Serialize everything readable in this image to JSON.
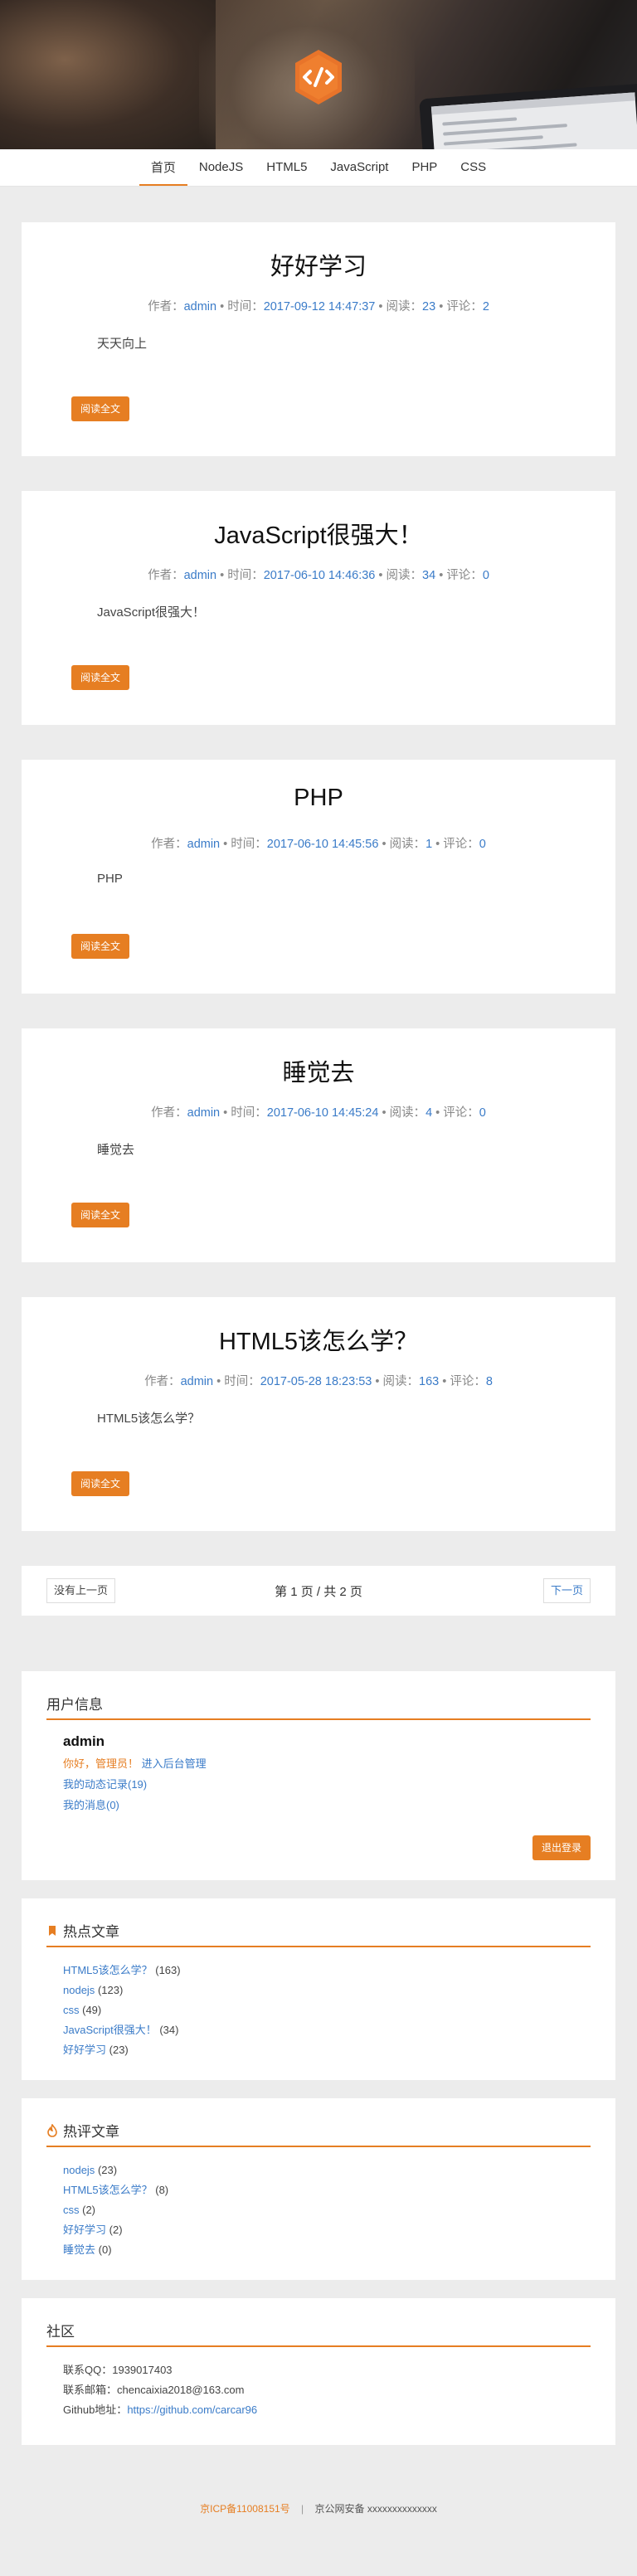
{
  "nav": {
    "items": [
      "首页",
      "NodeJS",
      "HTML5",
      "JavaScript",
      "PHP",
      "CSS"
    ]
  },
  "labels": {
    "author": "作者：",
    "time": "时间：",
    "reads": "阅读：",
    "comments": "评论：",
    "dot": " • ",
    "read_more": "阅读全文"
  },
  "posts": [
    {
      "title": "好好学习",
      "author": "admin",
      "time": "2017-09-12 14:47:37",
      "reads": "23",
      "comments": "2",
      "summary": "天天向上"
    },
    {
      "title": "JavaScript很强大！",
      "author": "admin",
      "time": "2017-06-10 14:46:36",
      "reads": "34",
      "comments": "0",
      "summary": "JavaScript很强大！"
    },
    {
      "title": "PHP",
      "author": "admin",
      "time": "2017-06-10 14:45:56",
      "reads": "1",
      "comments": "0",
      "summary": "PHP"
    },
    {
      "title": "睡觉去",
      "author": "admin",
      "time": "2017-06-10 14:45:24",
      "reads": "4",
      "comments": "0",
      "summary": "睡觉去"
    },
    {
      "title": "HTML5该怎么学？",
      "author": "admin",
      "time": "2017-05-28 18:23:53",
      "reads": "163",
      "comments": "8",
      "summary": "HTML5该怎么学？"
    }
  ],
  "pager": {
    "prev": "没有上一页",
    "info": "第 1 页 / 共 2 页",
    "next": "下一页"
  },
  "user_info": {
    "title": "用户信息",
    "name": "admin",
    "greeting": "你好，管理员！",
    "admin_link": "进入后台管理",
    "activity": "我的动态记录(19)",
    "messages": "我的消息(0)",
    "logout": "退出登录"
  },
  "hot_articles": {
    "title": "热点文章",
    "items": [
      {
        "label": "HTML5该怎么学？",
        "count": "(163)"
      },
      {
        "label": "nodejs",
        "count": "(123)"
      },
      {
        "label": "css",
        "count": "(49)"
      },
      {
        "label": "JavaScript很强大！",
        "count": "(34)"
      },
      {
        "label": "好好学习",
        "count": "(23)"
      }
    ]
  },
  "hot_comments": {
    "title": "热评文章",
    "items": [
      {
        "label": "nodejs",
        "count": "(23)"
      },
      {
        "label": "HTML5该怎么学？",
        "count": "(8)"
      },
      {
        "label": "css",
        "count": "(2)"
      },
      {
        "label": "好好学习",
        "count": "(2)"
      },
      {
        "label": "睡觉去",
        "count": "(0)"
      }
    ]
  },
  "community": {
    "title": "社区",
    "qq_label": "联系QQ：",
    "qq": "1939017403",
    "email_label": "联系邮箱：",
    "email": "chencaixia2018@163.com",
    "github_label": "Github地址：",
    "github": "https://github.com/carcar96"
  },
  "footer": {
    "icp": "京ICP备11008151号",
    "sep": "|",
    "police": "京公网安备 xxxxxxxxxxxxxx"
  },
  "colors": {
    "accent": "#e67e22",
    "link": "#3a7bc8",
    "background": "#ececec"
  }
}
